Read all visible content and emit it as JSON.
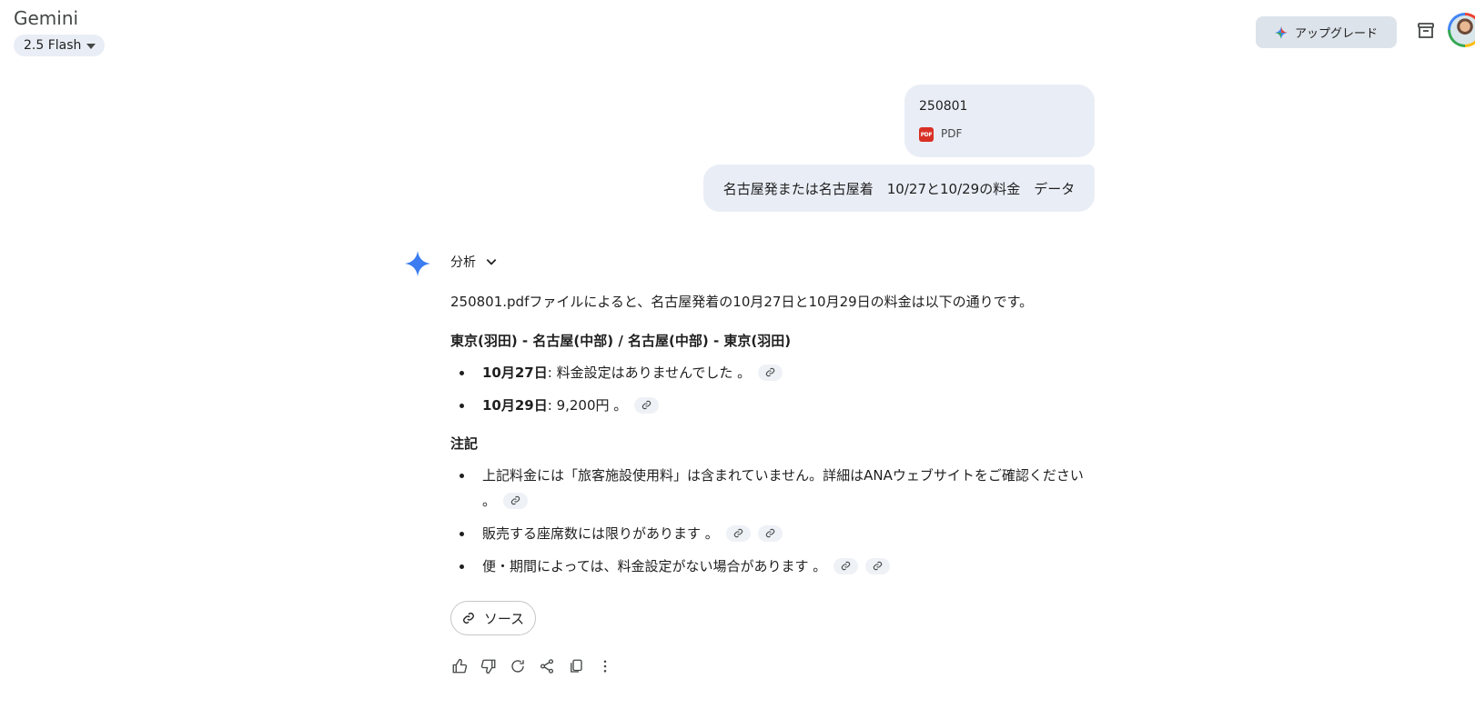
{
  "app": {
    "title": "Gemini",
    "model": "2.5 Flash"
  },
  "header": {
    "upgrade_label": "アップグレード"
  },
  "user": {
    "attachment": {
      "name": "250801",
      "type": "PDF"
    },
    "query": "名古屋発または名古屋着　10/27と10/29の料金　データ"
  },
  "response": {
    "analysis_label": "分析",
    "intro": "250801.pdfファイルによると、名古屋発着の10月27日と10月29日の料金は以下の通りです。",
    "route_heading": "東京(羽田) - 名古屋(中部) / 名古屋(中部) - 東京(羽田)",
    "fares": [
      {
        "date": "10月27日",
        "text": ": 料金設定はありませんでした 。"
      },
      {
        "date": "10月29日",
        "text": ": 9,200円 。"
      }
    ],
    "notes_heading": "注記",
    "notes": [
      "上記料金には「旅客施設使用料」は含まれていません。詳細はANAウェブサイトをご確認ください 。",
      "販売する座席数には限りがあります 。",
      "便・期間によっては、料金設定がない場合があります 。"
    ],
    "sources_label": "ソース"
  },
  "colors": {
    "accent": "#1a73e8",
    "bubble": "#e9eef6",
    "pdf": "#d93025"
  }
}
